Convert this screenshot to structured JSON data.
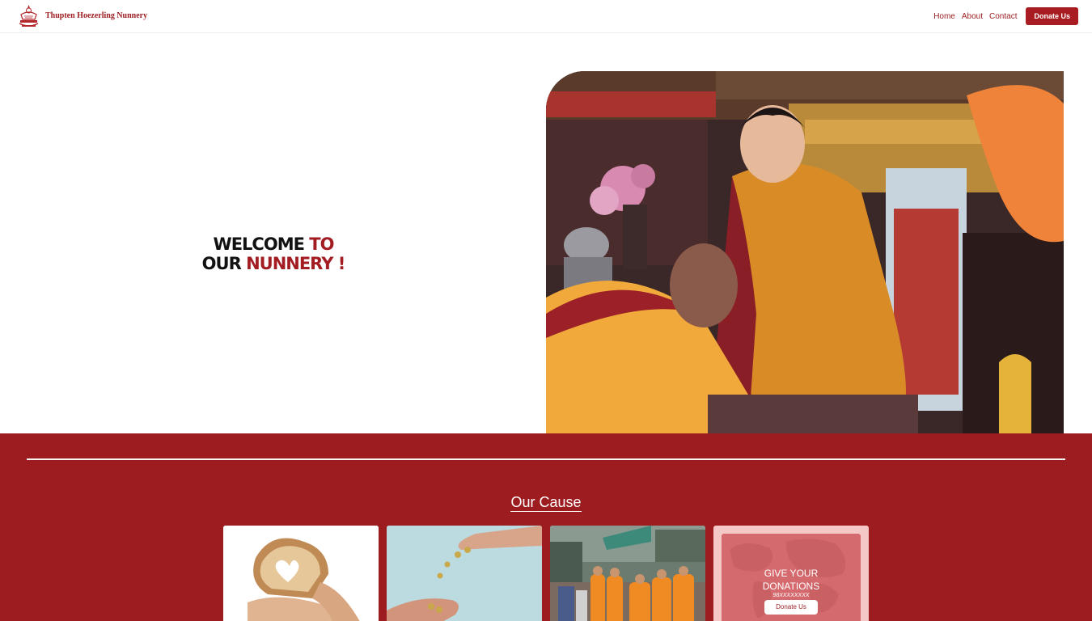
{
  "nav": {
    "brand": "Thupten Hoezerling Nunnery",
    "links": [
      "Home",
      "About",
      "Contact"
    ],
    "donate_label": "Donate Us"
  },
  "hero": {
    "heading_line1_a": "WELCOME",
    "heading_line1_b": "TO",
    "heading_line2_a": "OUR",
    "heading_line2_b": "NUNNERY !"
  },
  "cause": {
    "title": "Our Cause",
    "donation_card": {
      "line1": "GIVE YOUR",
      "line2": "DONATIONS",
      "phone": "98XXXXXXXX",
      "button_label": "Donate Us"
    }
  },
  "colors": {
    "brand_red": "#9c1c1f",
    "accent_red": "#a81c22"
  }
}
